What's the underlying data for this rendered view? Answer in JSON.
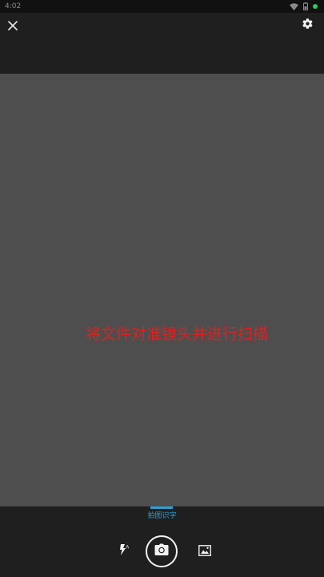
{
  "status_bar": {
    "time": "4:02",
    "icons": [
      "wifi-icon",
      "battery-icon",
      "notification-dot"
    ],
    "dot_color": "#2ecc55"
  },
  "top_bar": {
    "close_icon": "close-icon",
    "settings_icon": "gear-icon"
  },
  "viewfinder": {
    "hint": "将文件对准镜头并进行扫描",
    "hint_color": "#e02020"
  },
  "bottom_bar": {
    "active_tab": "拍图识字",
    "accent_color": "#2a9fd6",
    "controls": {
      "flash_icon": "flash-auto-icon",
      "shutter_icon": "camera-icon",
      "gallery_icon": "image-icon"
    }
  }
}
